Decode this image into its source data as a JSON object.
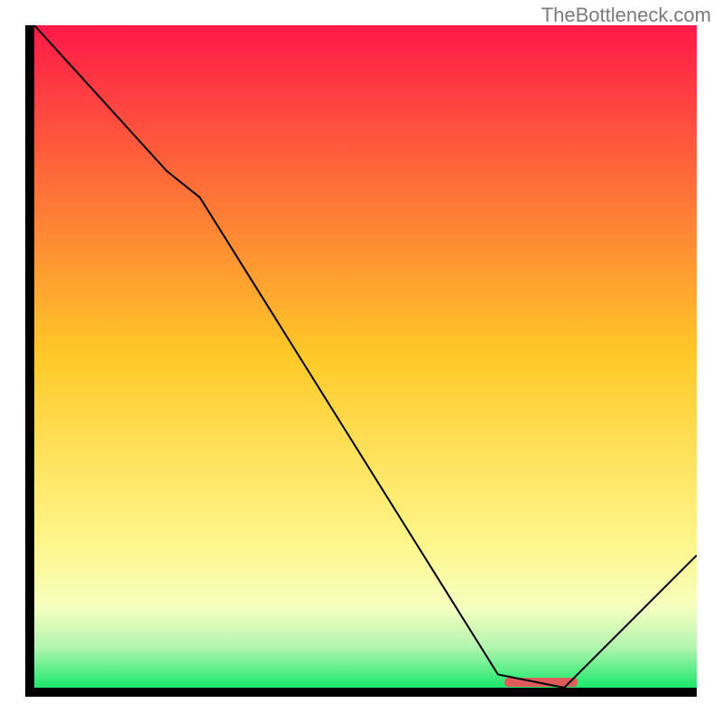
{
  "watermark_text": "TheBottleneck.com",
  "chart_data": {
    "type": "line",
    "x": [
      0,
      20,
      25,
      70,
      80,
      100
    ],
    "values": [
      100,
      78,
      74,
      2,
      0,
      20
    ],
    "title": "",
    "xlabel": "",
    "ylabel": "",
    "xlim": [
      0,
      100
    ],
    "ylim": [
      0,
      100
    ],
    "highlight_segment_x": [
      71,
      82
    ],
    "gradient_stops": [
      {
        "pos": 0.0,
        "color": "#ff1948"
      },
      {
        "pos": 0.5,
        "color": "#ffca28"
      },
      {
        "pos": 0.78,
        "color": "#fff68a"
      },
      {
        "pos": 0.88,
        "color": "#f5ffbf"
      },
      {
        "pos": 0.94,
        "color": "#b0f5ae"
      },
      {
        "pos": 1.0,
        "color": "#19e86b"
      }
    ],
    "line_color": "#000000",
    "line_width": 2,
    "highlight_color": "#e15a5a",
    "highlight_y_abs": 0
  }
}
